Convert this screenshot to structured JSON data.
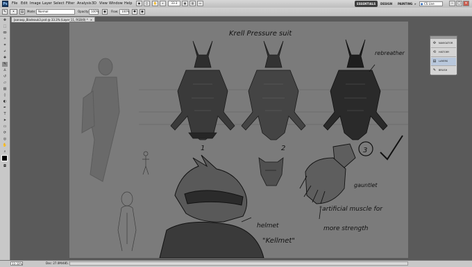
{
  "app": {
    "logo": "Ps"
  },
  "menus": [
    "File",
    "Edit",
    "Image",
    "Layer",
    "Select",
    "Filter",
    "Analysis",
    "3D",
    "View",
    "Window",
    "Help"
  ],
  "menubar_extras": {
    "zoom": "33.3"
  },
  "workspaces": {
    "essentials": "ESSENTIALS",
    "design": "DESIGN",
    "painting": "PAINTING",
    "more": "»"
  },
  "cslive": "CS Live",
  "window_controls": {
    "minimize": "–",
    "restore": "□",
    "close": "✕"
  },
  "options": {
    "mode_label": "Mode:",
    "mode_value": "Normal",
    "opacity_label": "Opacity:",
    "opacity_value": "100%",
    "flow_label": "Flow:",
    "flow_value": "100%"
  },
  "doc_tab": {
    "title": "Jaanasp_Bladeauk3.psd @ 33.3% (Layer 11, RGB/8) *",
    "close": "×"
  },
  "panel": {
    "items": [
      {
        "label": "NAVIGATOR",
        "icon": "navigator-icon",
        "glyph": "✣"
      },
      {
        "label": "HISTORY",
        "icon": "history-icon",
        "glyph": "⟲"
      },
      {
        "label": "LAYERS",
        "icon": "layers-icon",
        "glyph": "▤"
      },
      {
        "label": "BRUSH",
        "icon": "brush-icon",
        "glyph": "✎"
      }
    ]
  },
  "canvas_text": {
    "title": "Krell Pressure suit",
    "rebreather": "rebreather",
    "num1": "1",
    "num2": "2",
    "num3": "3",
    "gauntlet": "gauntlet",
    "muscle_line1": "\"artificial muscle for",
    "muscle_line2": "more strength",
    "helmet": "helmet",
    "kellmet": "\"Kellmet\""
  },
  "status": {
    "zoom": "33.33%",
    "doc": "Doc: 27.0M/485.7M"
  },
  "colors": {
    "canvas": "#7b7b7b",
    "workspace": "#5a5a5a",
    "ink": "#111111"
  }
}
